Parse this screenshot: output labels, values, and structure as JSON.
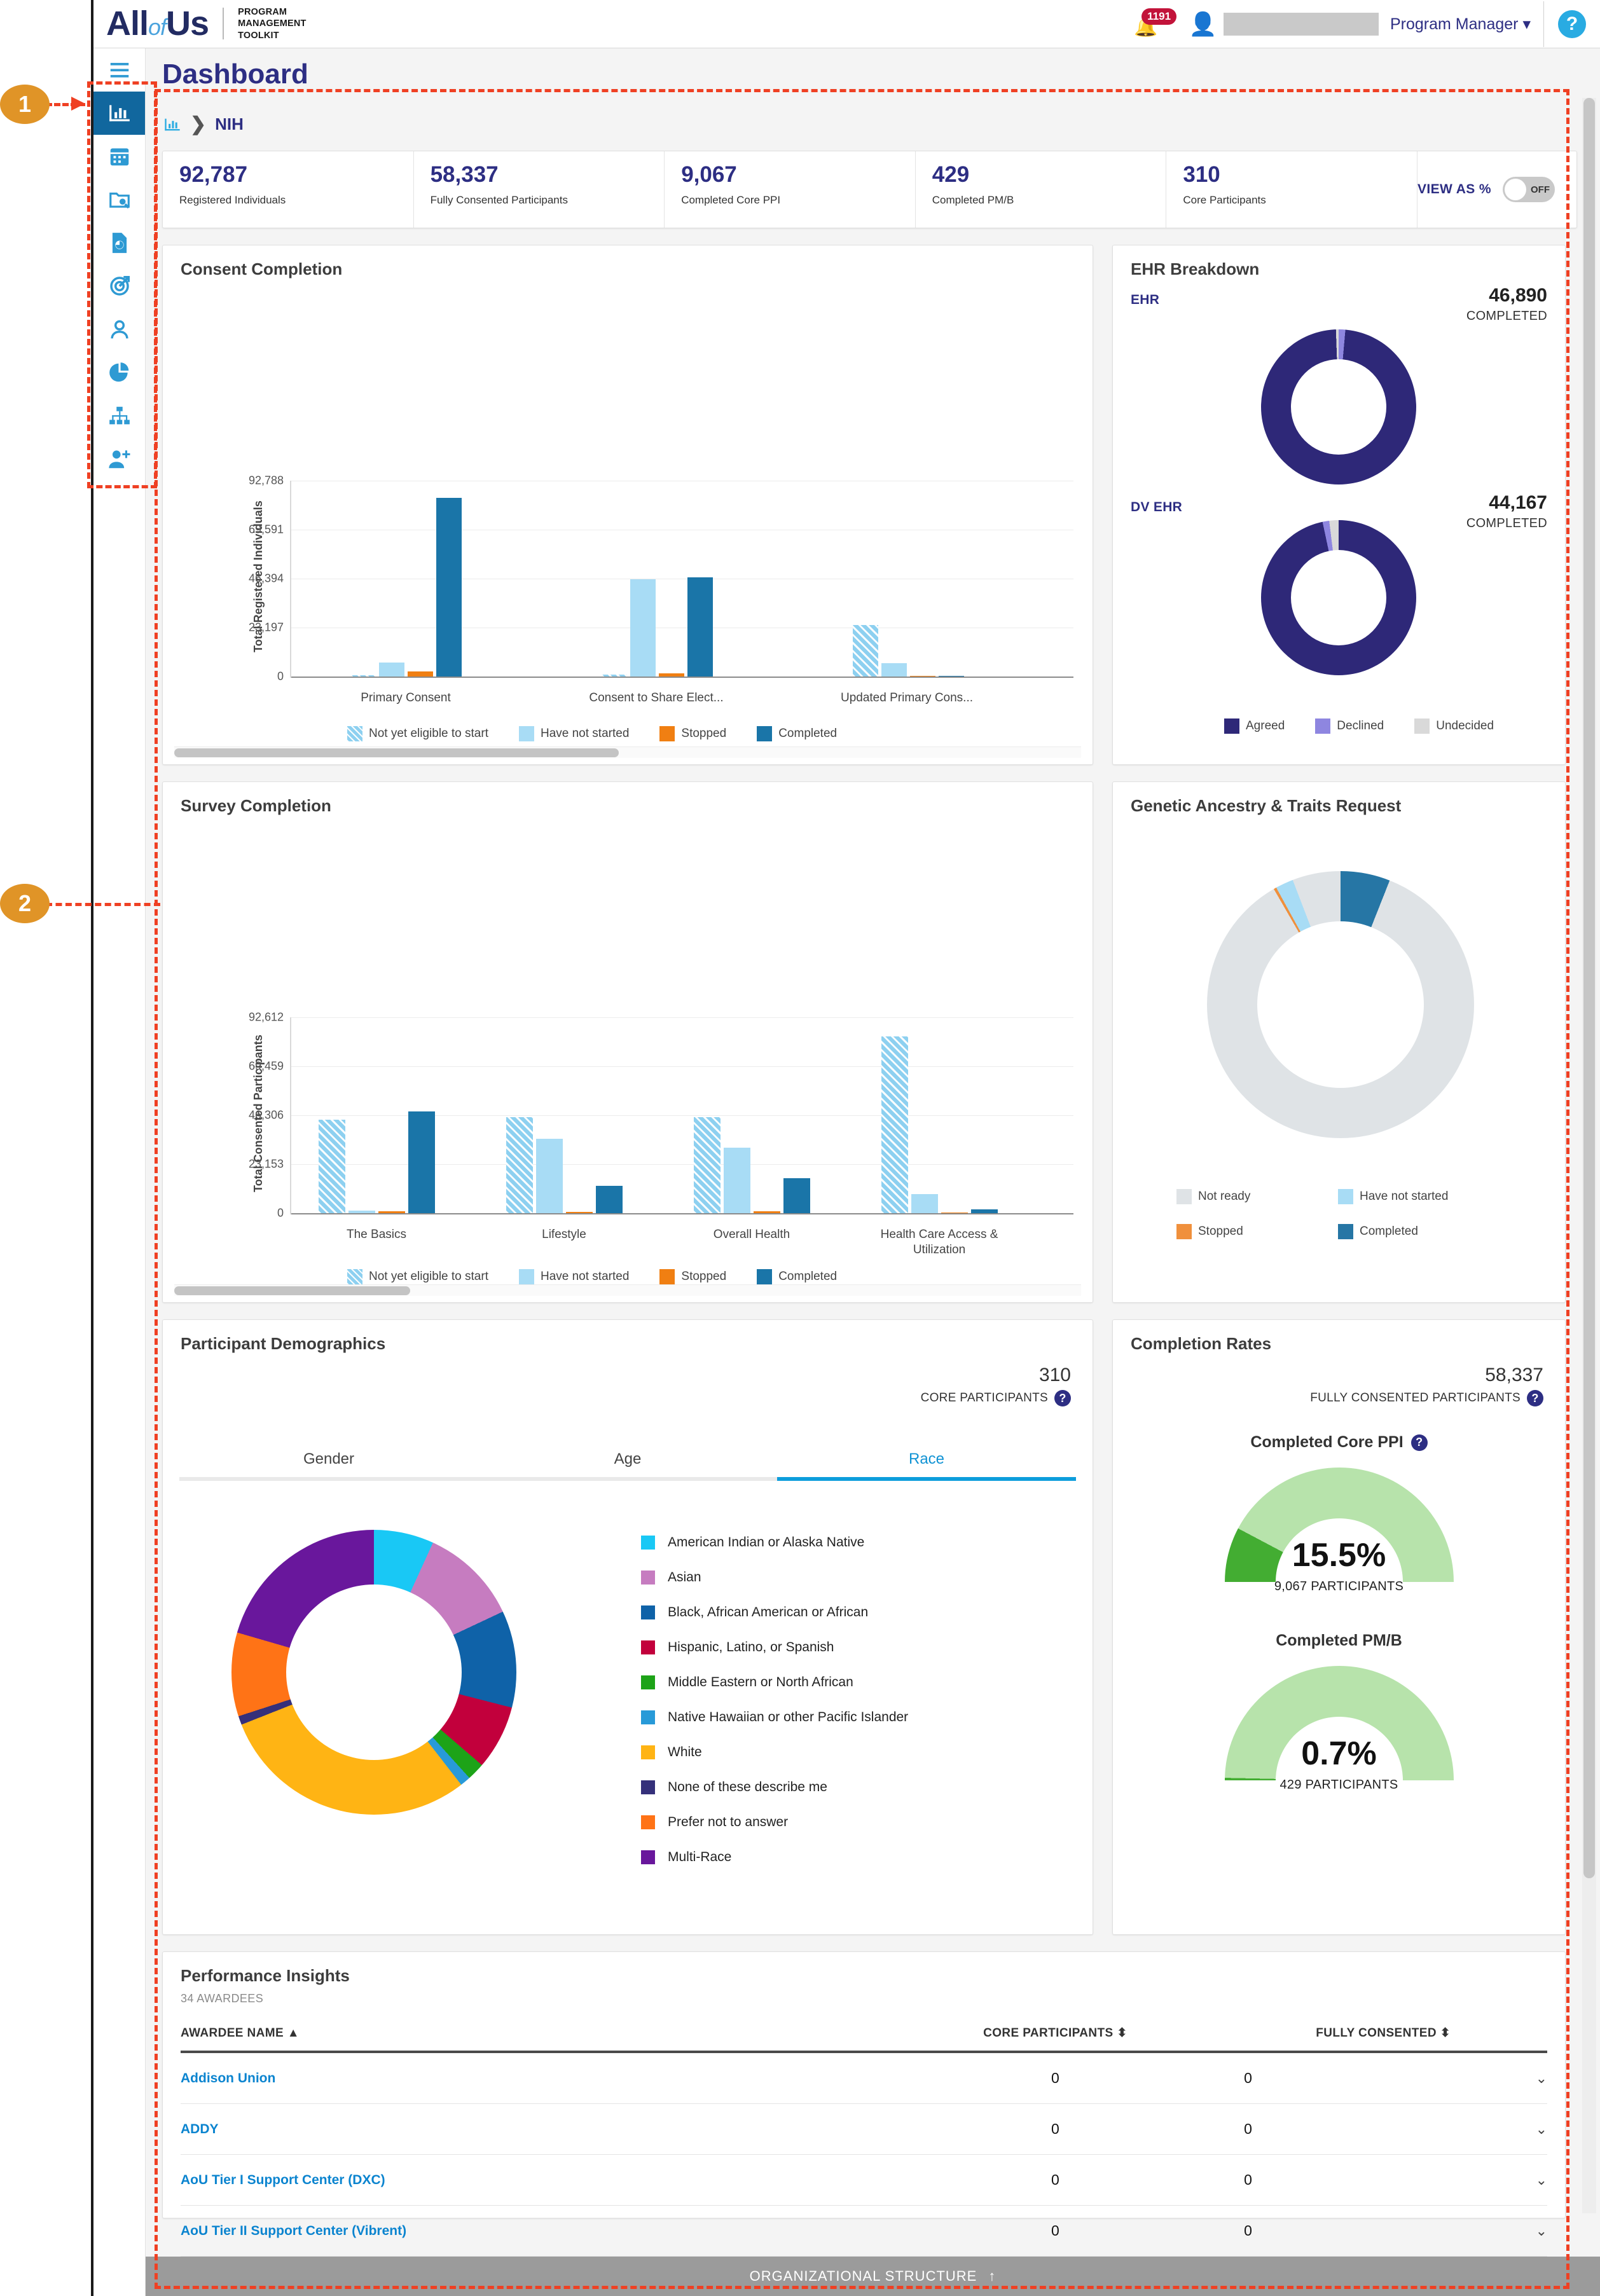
{
  "header": {
    "logo_main": "All",
    "logo_of": "of",
    "logo_us": "Us",
    "logo_subtitle_l1": "PROGRAM",
    "logo_subtitle_l2": "MANAGEMENT",
    "logo_subtitle_l3": "TOOLKIT",
    "notification_count": "1191",
    "role_label": "Program Manager",
    "role_caret": "▾",
    "help_label": "?"
  },
  "sidebar": {
    "items": [
      {
        "name": "menu",
        "icon": "hamburger-icon",
        "active": false
      },
      {
        "name": "dashboard",
        "icon": "bar-chart-icon",
        "active": true
      },
      {
        "name": "calendar",
        "icon": "calendar-icon",
        "active": false
      },
      {
        "name": "folder-search",
        "icon": "folder-search-icon",
        "active": false
      },
      {
        "name": "report",
        "icon": "document-chart-icon",
        "active": false
      },
      {
        "name": "target",
        "icon": "target-arrow-icon",
        "active": false
      },
      {
        "name": "profile",
        "icon": "person-icon",
        "active": false
      },
      {
        "name": "analytics",
        "icon": "pie-chart-icon",
        "active": false
      },
      {
        "name": "org-chart",
        "icon": "hierarchy-icon",
        "active": false
      },
      {
        "name": "add-user",
        "icon": "person-add-icon",
        "active": false
      }
    ]
  },
  "page": {
    "title": "Dashboard",
    "breadcrumb_icon": "bar-chart-icon",
    "breadcrumb_sep": "❯",
    "breadcrumb_current": "NIH"
  },
  "kpis": [
    {
      "value": "92,787",
      "label": "Registered Individuals"
    },
    {
      "value": "58,337",
      "label": "Fully Consented Participants"
    },
    {
      "value": "9,067",
      "label": "Completed Core PPI"
    },
    {
      "value": "429",
      "label": "Completed PM/B"
    },
    {
      "value": "310",
      "label": "Core Participants"
    }
  ],
  "view_as": {
    "label": "VIEW AS %",
    "state": "OFF"
  },
  "panels": {
    "consent_completion_title": "Consent Completion",
    "ehr_breakdown_title": "EHR Breakdown",
    "survey_completion_title": "Survey Completion",
    "genetic_title": "Genetic Ancestry & Traits Request",
    "demographics_title": "Participant Demographics",
    "completion_rates_title": "Completion Rates",
    "performance_insights_title": "Performance Insights",
    "performance_insights_sub": "34 AWARDEES"
  },
  "ehr": {
    "ehr_label": "EHR",
    "ehr_value": "46,890",
    "ehr_sub": "COMPLETED",
    "dv_label": "DV EHR",
    "dv_value": "44,167",
    "dv_sub": "COMPLETED",
    "legend": [
      {
        "label": "Agreed",
        "color": "#2e2878"
      },
      {
        "label": "Declined",
        "color": "#8e86e0"
      },
      {
        "label": "Undecided",
        "color": "#d9d9d9"
      }
    ]
  },
  "demographics": {
    "tabs": [
      {
        "label": "Gender",
        "active": false
      },
      {
        "label": "Age",
        "active": false
      },
      {
        "label": "Race",
        "active": true
      }
    ],
    "count": "310",
    "count_label": "CORE PARTICIPANTS",
    "help_glyph": "?"
  },
  "completion_rates": {
    "count": "58,337",
    "count_label": "FULLY CONSENTED PARTICIPANTS",
    "help_glyph": "?",
    "gauges": [
      {
        "title": "Completed Core PPI",
        "has_help": true,
        "pct": "15.5%",
        "sub": "9,067 PARTICIPANTS",
        "value": 15.5
      },
      {
        "title": "Completed PM/B",
        "has_help": false,
        "pct": "0.7%",
        "sub": "429 PARTICIPANTS",
        "value": 0.7
      }
    ],
    "track_color": "#b7e3ab",
    "fill_color": "#43ad32"
  },
  "table": {
    "columns": [
      {
        "label": "AWARDEE NAME",
        "sort": "▲"
      },
      {
        "label": "CORE PARTICIPANTS",
        "sort": "⬍"
      },
      {
        "label": "FULLY CONSENTED",
        "sort": "⬍"
      }
    ],
    "rows": [
      {
        "name": "Addison Union",
        "core": "0",
        "consented": "0",
        "chevron": "⌄"
      },
      {
        "name": "ADDY",
        "core": "0",
        "consented": "0",
        "chevron": "⌄"
      },
      {
        "name": "AoU Tier I Support Center (DXC)",
        "core": "0",
        "consented": "0",
        "chevron": "⌄"
      },
      {
        "name": "AoU Tier II Support Center (Vibrent)",
        "core": "0",
        "consented": "0",
        "chevron": "⌄"
      }
    ],
    "footer_label": "ORGANIZATIONAL STRUCTURE",
    "footer_arrow": "↑"
  },
  "annotations": [
    {
      "id": "1",
      "label": "1"
    },
    {
      "id": "2",
      "label": "2"
    }
  ],
  "chart_data": [
    {
      "type": "bar",
      "id": "consent-completion",
      "title": "Consent Completion",
      "ylabel": "Total Registered Individuals",
      "xlabel": "",
      "categories": [
        "Primary Consent",
        "Consent to Share Elect...",
        "Updated Primary Cons..."
      ],
      "yticks": [
        "0",
        "23,197",
        "46,394",
        "69,591",
        "92,788"
      ],
      "ylim": [
        0,
        92788
      ],
      "grid": true,
      "legend_position": "bottom",
      "series": [
        {
          "name": "Not yet eligible to start",
          "color": "#8dd0f0",
          "hatched": true,
          "values": [
            0,
            400,
            24000
          ]
        },
        {
          "name": "Have not started",
          "color": "#a8dcf5",
          "hatched": false,
          "values": [
            6300,
            45800,
            6000
          ]
        },
        {
          "name": "Stopped",
          "color": "#f07f12",
          "hatched": false,
          "values": [
            2000,
            600,
            0
          ]
        },
        {
          "name": "Completed",
          "color": "#1a75a8",
          "hatched": false,
          "values": [
            84200,
            46800,
            0
          ]
        }
      ]
    },
    {
      "type": "bar",
      "id": "survey-completion",
      "title": "Survey Completion",
      "ylabel": "Total Consented Participants",
      "xlabel": "",
      "categories": [
        "The Basics",
        "Lifestyle",
        "Overall Health",
        "Health Care Access & Utilization"
      ],
      "yticks": [
        "0",
        "23,153",
        "46,306",
        "69,459",
        "92,612"
      ],
      "ylim": [
        0,
        92612
      ],
      "grid": true,
      "legend_position": "bottom",
      "series": [
        {
          "name": "Not yet eligible to start",
          "color": "#8dd0f0",
          "hatched": true,
          "values": [
            43900,
            45200,
            45200,
            83000
          ]
        },
        {
          "name": "Have not started",
          "color": "#a8dcf5",
          "hatched": false,
          "values": [
            900,
            35000,
            31000,
            8800
          ]
        },
        {
          "name": "Stopped",
          "color": "#f07f12",
          "hatched": false,
          "values": [
            400,
            0,
            400,
            0
          ]
        },
        {
          "name": "Completed",
          "color": "#1a75a8",
          "hatched": false,
          "values": [
            47800,
            12700,
            16400,
            1300
          ]
        }
      ]
    },
    {
      "type": "pie",
      "id": "ehr-donut",
      "title": "EHR",
      "labels": [
        "Agreed",
        "Declined",
        "Undecided"
      ],
      "values": [
        98.2,
        1.3,
        0.5
      ],
      "colors": [
        "#2e2878",
        "#8e86e0",
        "#d9d9d9"
      ],
      "center_value": "46,890",
      "center_label": "COMPLETED"
    },
    {
      "type": "pie",
      "id": "dv-ehr-donut",
      "title": "DV EHR",
      "labels": [
        "Agreed",
        "Declined",
        "Undecided"
      ],
      "values": [
        96.5,
        0.9,
        2.6
      ],
      "colors": [
        "#2e2878",
        "#8e86e0",
        "#d9d9d9"
      ],
      "center_value": "44,167",
      "center_label": "COMPLETED"
    },
    {
      "type": "pie",
      "id": "genetic-ancestry-donut",
      "title": "Genetic Ancestry & Traits Request",
      "labels": [
        "Not ready",
        "Have not started",
        "Stopped",
        "Completed"
      ],
      "values": [
        91.5,
        2.2,
        0.3,
        6.0
      ],
      "colors": [
        "#dfe3e6",
        "#a8dcf5",
        "#f0903c",
        "#2676a5"
      ],
      "legend_position": "bottom"
    },
    {
      "type": "pie",
      "id": "race-donut",
      "title": "Participant Demographics — Race",
      "labels": [
        "American Indian or Alaska Native",
        "Asian",
        "Black, African American or African",
        "Hispanic, Latino, or Spanish",
        "Middle Eastern or North African",
        "Native Hawaiian or other Pacific Islander",
        "White",
        "None of these describe me",
        "Prefer not to answer",
        "Multi-Race"
      ],
      "colors": [
        "#19c8f5",
        "#c67cc0",
        "#0f62a8",
        "#c2003c",
        "#1da318",
        "#289ad8",
        "#ffb414",
        "#35307a",
        "#ff7316",
        "#69179c"
      ],
      "values": [
        6.8,
        11.2,
        11.0,
        7.3,
        2.0,
        1.2,
        29.5,
        1.0,
        9.5,
        10.5
      ]
    },
    {
      "type": "bar",
      "id": "completion-gauges",
      "title": "Completion Rates",
      "categories": [
        "Completed Core PPI",
        "Completed PM/B"
      ],
      "values": [
        15.5,
        0.7
      ],
      "ylabel": "%",
      "ylim": [
        0,
        100
      ]
    }
  ]
}
